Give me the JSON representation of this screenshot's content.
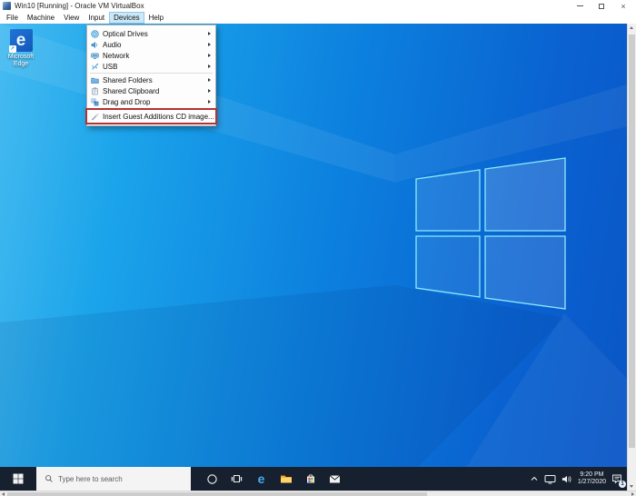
{
  "window": {
    "title": "Win10 [Running] - Oracle VM VirtualBox",
    "close_glyph": "×",
    "controls": [
      "minimize",
      "maximize",
      "close"
    ]
  },
  "menubar": {
    "items": [
      {
        "label": "File"
      },
      {
        "label": "Machine"
      },
      {
        "label": "View"
      },
      {
        "label": "Input"
      },
      {
        "label": "Devices",
        "active": true
      },
      {
        "label": "Help"
      }
    ]
  },
  "devices_menu": {
    "items": [
      {
        "label": "Optical Drives",
        "icon": "optical-drive-icon",
        "has_submenu": true
      },
      {
        "label": "Audio",
        "icon": "audio-icon",
        "has_submenu": true
      },
      {
        "label": "Network",
        "icon": "network-icon",
        "has_submenu": true
      },
      {
        "label": "USB",
        "icon": "usb-icon",
        "has_submenu": true
      },
      {
        "label": "Shared Folders",
        "icon": "shared-folders-icon",
        "has_submenu": true
      },
      {
        "label": "Shared Clipboard",
        "icon": "shared-clipboard-icon",
        "has_submenu": true
      },
      {
        "label": "Drag and Drop",
        "icon": "drag-and-drop-icon",
        "has_submenu": true
      },
      {
        "label": "Insert Guest Additions CD image...",
        "icon": "guest-additions-icon",
        "has_submenu": false,
        "annotated": true
      }
    ],
    "annotation_color": "#b53232"
  },
  "desktop": {
    "icons": [
      {
        "label": "Microsoft Edge",
        "icon": "edge-icon",
        "glyph": "e",
        "shortcut_arrow": "↗"
      }
    ]
  },
  "taskbar": {
    "search": {
      "placeholder": "Type here to search",
      "icon": "search-icon"
    },
    "app_icons": [
      "start",
      "cortana",
      "task-view",
      "edge",
      "file-explorer",
      "store",
      "mail"
    ],
    "tray": {
      "time": "9:20 PM",
      "date": "1/27/2020",
      "icons": [
        "hidden-icons-chevron",
        "display-network",
        "volume",
        "action-center"
      ],
      "action_center_badge": "1"
    }
  },
  "colors": {
    "annotation_red": "#b53232",
    "menubar_highlight": "#cbe8f6",
    "taskbar_bg": "#17202e",
    "wallpaper_light": "#46bbf0",
    "wallpaper_deep": "#0a55c6",
    "edge_blue": "#48a8f0",
    "folder_yellow": "#ffd567"
  }
}
